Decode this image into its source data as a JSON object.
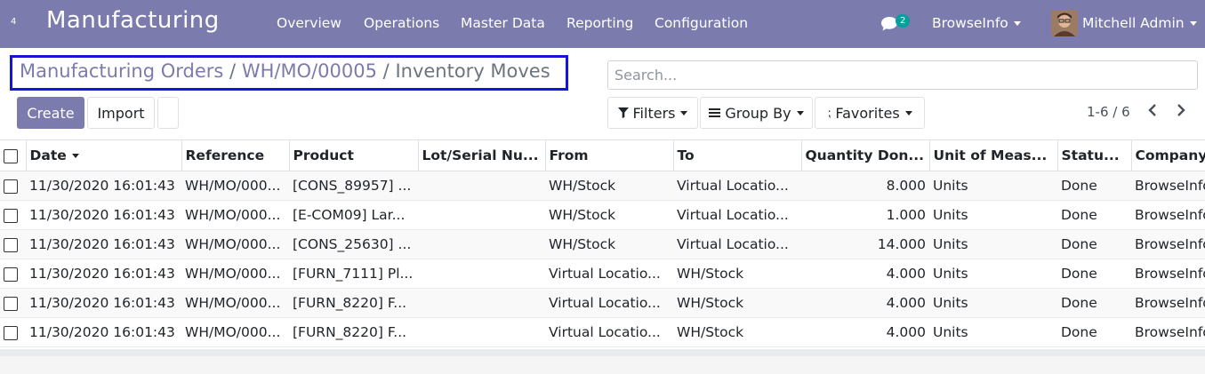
{
  "navbar": {
    "grid_indicator": "4",
    "app_title": "Manufacturing",
    "menu": [
      "Overview",
      "Operations",
      "Master Data",
      "Reporting",
      "Configuration"
    ],
    "chat_count": "2",
    "company": "BrowseInfo",
    "user": "Mitchell Admin"
  },
  "breadcrumb": {
    "items": [
      "Manufacturing Orders",
      "WH/MO/00005",
      "Inventory Moves"
    ],
    "separator": "/"
  },
  "search": {
    "placeholder": "Search..."
  },
  "buttons": {
    "create": "Create",
    "import": "Import"
  },
  "filters": {
    "filters": "Filters",
    "group_by": "Group By",
    "favorites": "Favorites"
  },
  "pager": {
    "value": "1-6 / 6"
  },
  "colors": {
    "navbar": "#7c7bad",
    "highlight_box": "#1515d8"
  },
  "table": {
    "columns": [
      "Date",
      "Reference",
      "Product",
      "Lot/Serial Nu...",
      "From",
      "To",
      "Quantity Don...",
      "Unit of Meas...",
      "Statu...",
      "Company"
    ],
    "rows": [
      [
        "11/30/2020 16:01:43",
        "WH/MO/000...",
        "[CONS_89957] ...",
        "",
        "WH/Stock",
        "Virtual Locatio...",
        "8.000",
        "Units",
        "Done",
        "BrowseInfo"
      ],
      [
        "11/30/2020 16:01:43",
        "WH/MO/000...",
        "[E-COM09] Lar...",
        "",
        "WH/Stock",
        "Virtual Locatio...",
        "1.000",
        "Units",
        "Done",
        "BrowseInfo"
      ],
      [
        "11/30/2020 16:01:43",
        "WH/MO/000...",
        "[CONS_25630] ...",
        "",
        "WH/Stock",
        "Virtual Locatio...",
        "14.000",
        "Units",
        "Done",
        "BrowseInfo"
      ],
      [
        "11/30/2020 16:01:43",
        "WH/MO/000...",
        "[FURN_7111] Pl...",
        "",
        "Virtual Locatio...",
        "WH/Stock",
        "4.000",
        "Units",
        "Done",
        "BrowseInfo"
      ],
      [
        "11/30/2020 16:01:43",
        "WH/MO/000...",
        "[FURN_8220] F...",
        "",
        "Virtual Locatio...",
        "WH/Stock",
        "4.000",
        "Units",
        "Done",
        "BrowseInfo"
      ],
      [
        "11/30/2020 16:01:43",
        "WH/MO/000...",
        "[FURN_8220] F...",
        "",
        "Virtual Locatio...",
        "WH/Stock",
        "4.000",
        "Units",
        "Done",
        "BrowseInfo"
      ]
    ]
  }
}
